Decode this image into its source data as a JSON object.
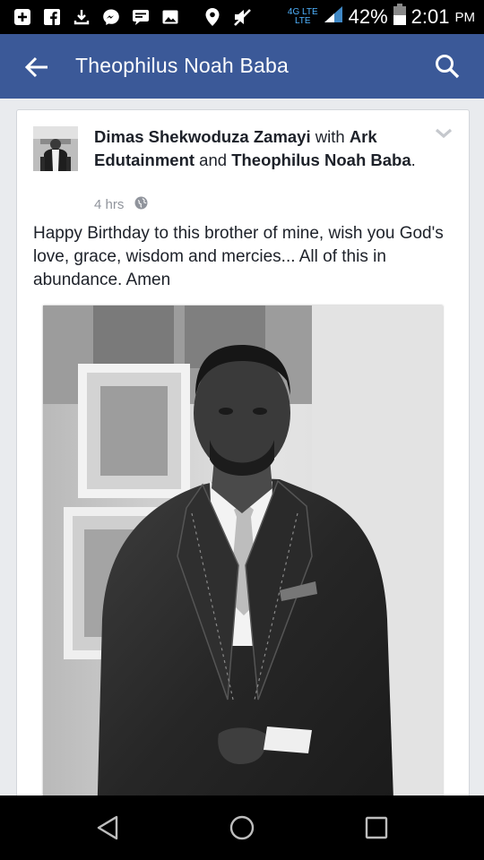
{
  "status_bar": {
    "network_top": "4G LTE",
    "network_bottom": "LTE",
    "battery": "42%",
    "time": "2:01",
    "ampm": "PM",
    "notification_icons": [
      "add-box-icon",
      "facebook-icon",
      "download-icon",
      "messenger-icon",
      "chat-icon",
      "image-icon",
      "location-icon",
      "mute-icon"
    ]
  },
  "app_bar": {
    "title": "Theophilus Noah Baba",
    "color": "#3b5998"
  },
  "post": {
    "author": "Dimas Shekwoduza Zamayi",
    "with_word": " with ",
    "tagged_1": "Ark Edutainment",
    "and_word": " and ",
    "tagged_2": "Theophilus Noah Baba",
    "period": ".",
    "time": "4 hrs",
    "privacy_icon": "globe-icon",
    "text": "Happy Birthday to this brother of mine, wish you God's love, grace, wisdom and mercies... All of this in abundance. Amen"
  },
  "nav_bar": {
    "buttons": [
      "back-triangle-icon",
      "home-circle-icon",
      "recents-square-icon"
    ]
  }
}
